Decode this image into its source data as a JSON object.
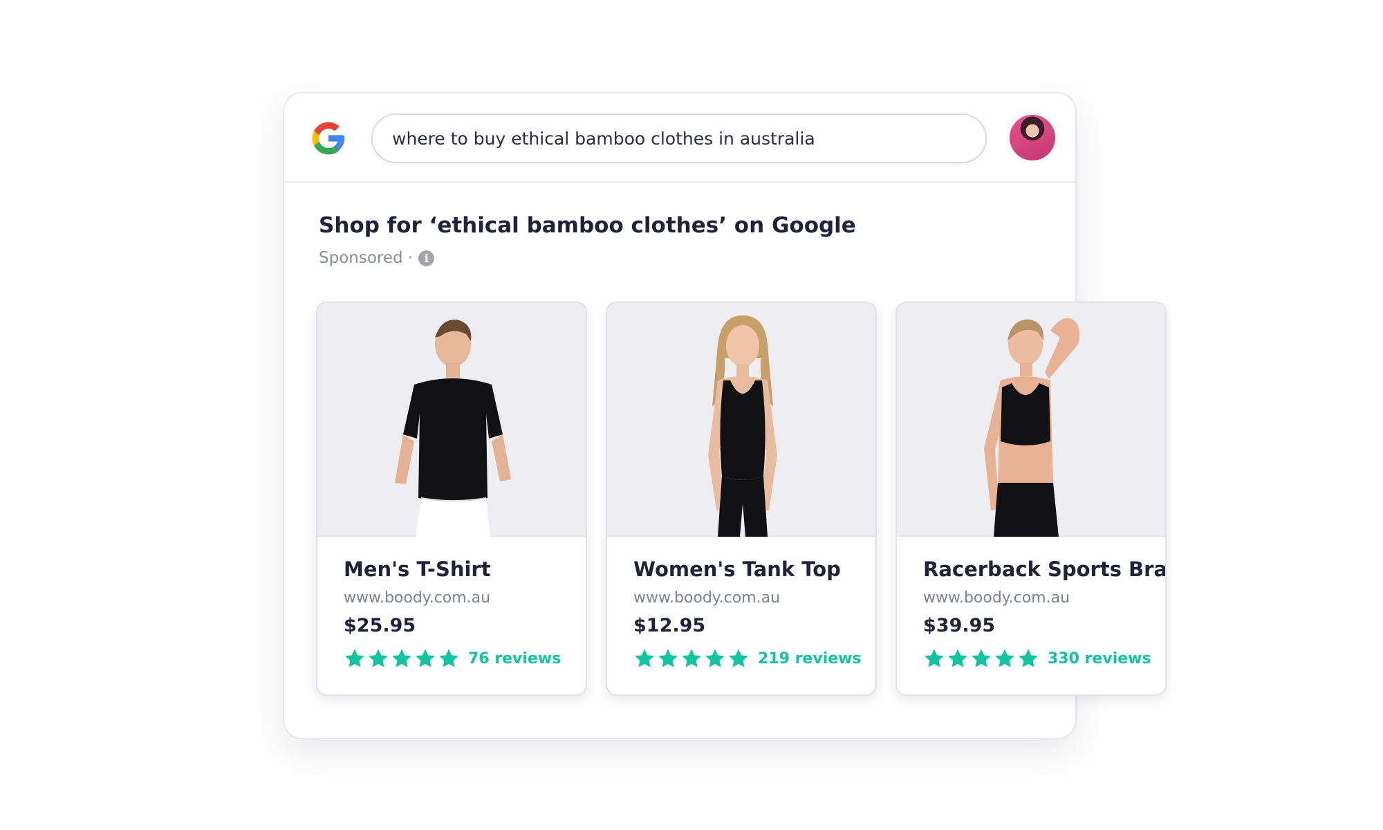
{
  "search": {
    "query": "where to buy ethical bamboo clothes in australia",
    "logo": "google-g-icon",
    "avatar": "user-avatar"
  },
  "section": {
    "title": "Shop for ‘ethical bamboo clothes’ on Google",
    "sponsored": "Sponsored ·",
    "info_icon": "info-icon"
  },
  "colors": {
    "star": "#12c5a0",
    "reviews": "#12c5a0",
    "card_image_bg": "#eeeef2"
  },
  "products": [
    {
      "title": "Men's T-Shirt",
      "url": "www.boody.com.au",
      "price": "$25.95",
      "stars": 5,
      "reviews": "76 reviews"
    },
    {
      "title": "Women's Tank Top",
      "url": "www.boody.com.au",
      "price": "$12.95",
      "stars": 5,
      "reviews": "219 reviews"
    },
    {
      "title": "Racerback Sports Bra",
      "url": "www.boody.com.au",
      "price": "$39.95",
      "stars": 5,
      "reviews": "330 reviews"
    }
  ]
}
